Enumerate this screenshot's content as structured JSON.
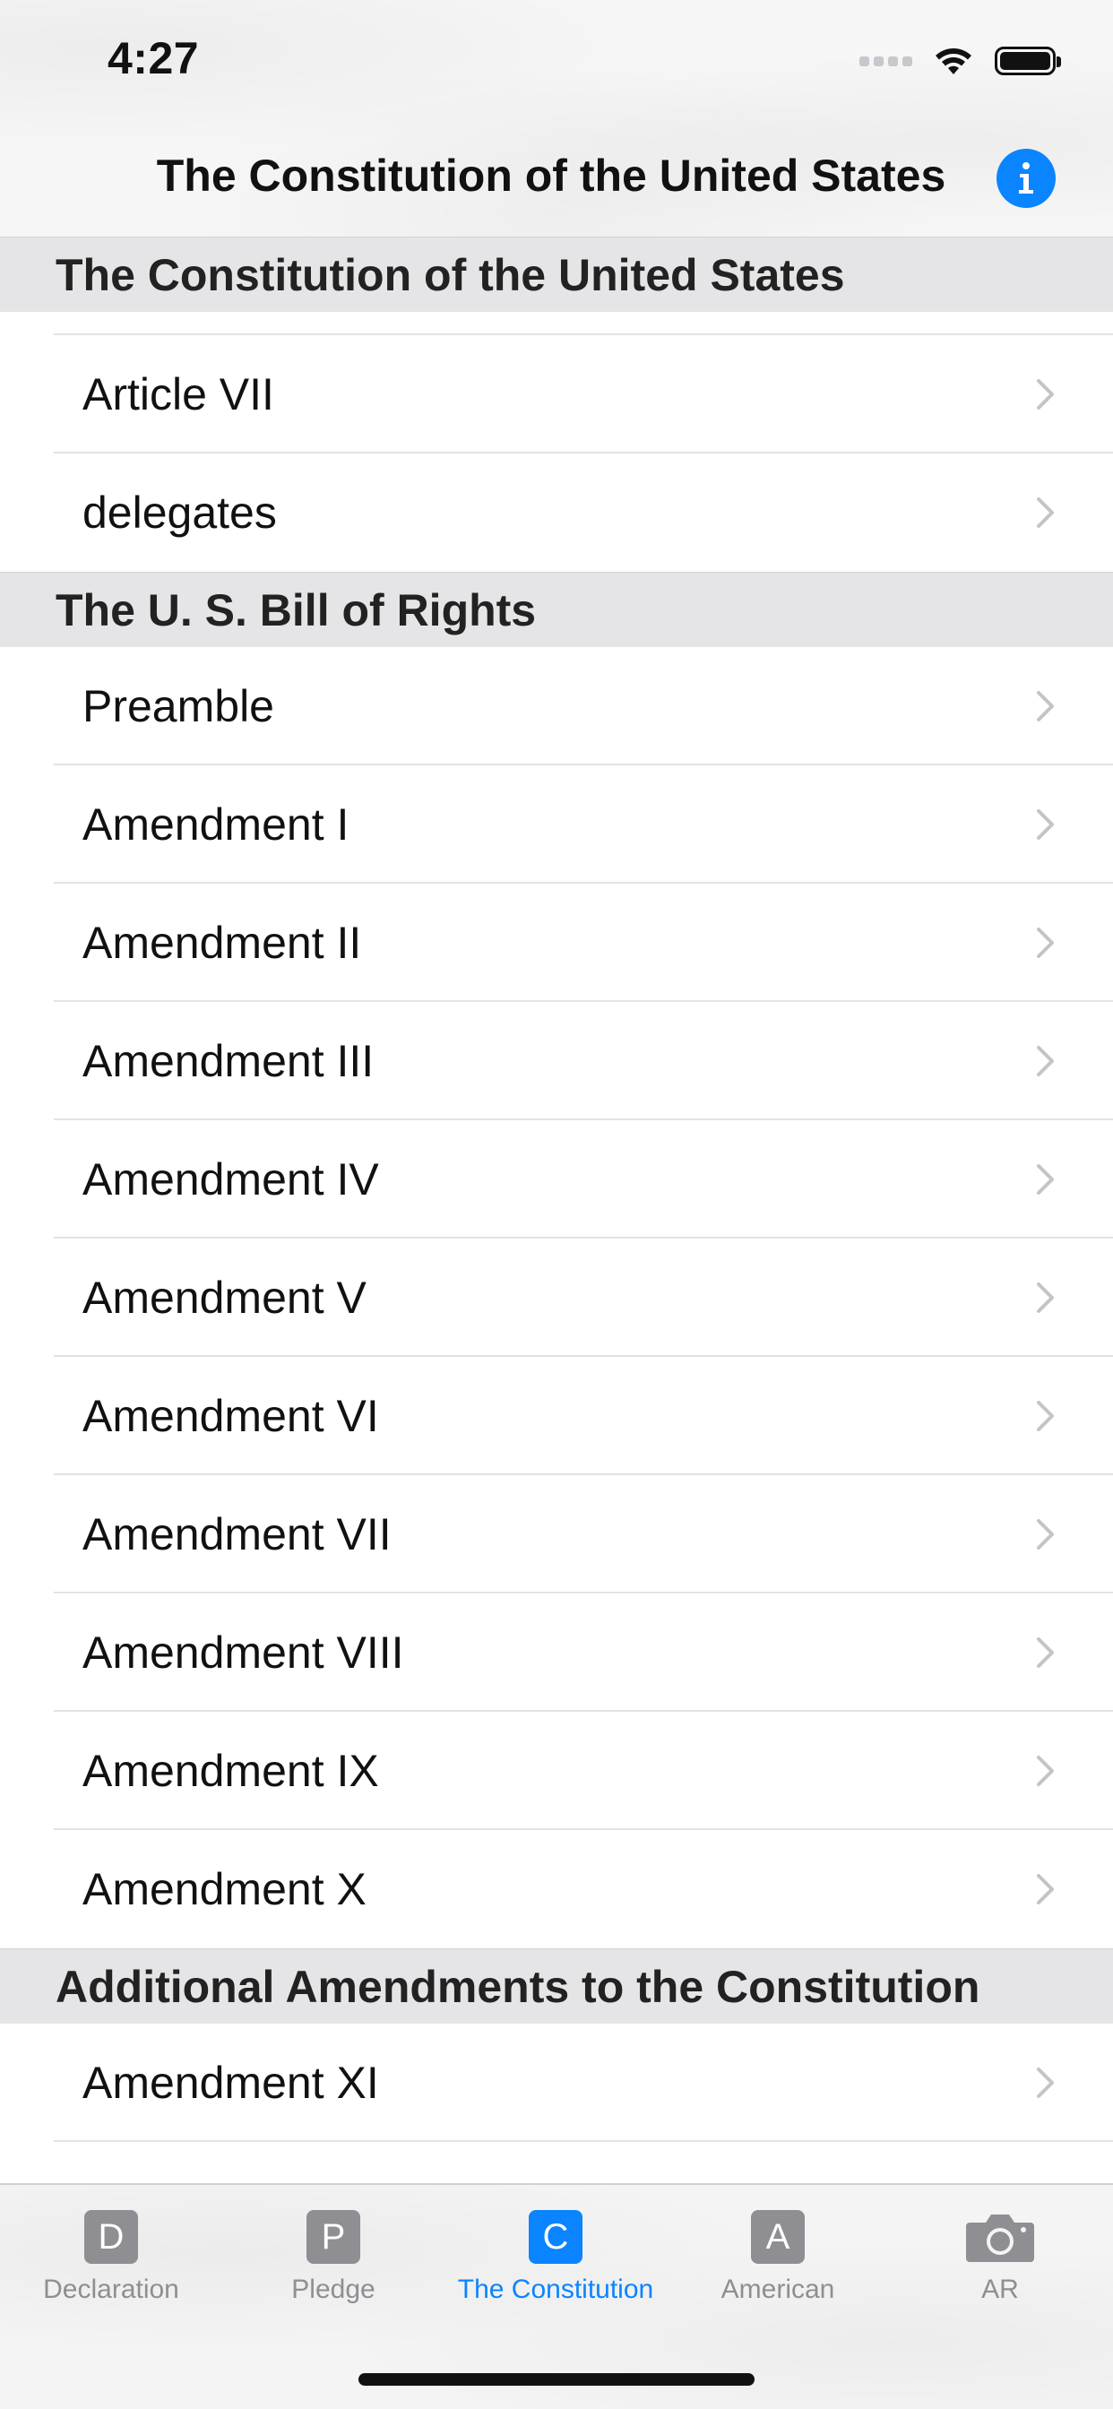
{
  "status_bar": {
    "time": "4:27"
  },
  "nav": {
    "title": "The Constitution of the United States",
    "info_icon": "info-icon"
  },
  "sections": [
    {
      "header": "The Constitution of the United States",
      "rows": [
        "Article VII",
        "delegates"
      ]
    },
    {
      "header": "The U. S. Bill of Rights",
      "rows": [
        "Preamble",
        "Amendment I",
        "Amendment II",
        "Amendment III",
        "Amendment IV",
        "Amendment V",
        "Amendment VI",
        "Amendment VII",
        "Amendment VIII",
        "Amendment IX",
        "Amendment X"
      ]
    },
    {
      "header": "Additional Amendments to the Constitution",
      "rows": [
        "Amendment XI"
      ]
    }
  ],
  "tabs": [
    {
      "letter": "D",
      "label": "Declaration"
    },
    {
      "letter": "P",
      "label": "Pledge"
    },
    {
      "letter": "C",
      "label": "The Constitution"
    },
    {
      "letter": "A",
      "label": "American"
    },
    {
      "letter": "",
      "label": "AR"
    }
  ],
  "active_tab": "The Constitution",
  "colors": {
    "accent": "#0a84ff",
    "inactive": "#8e8e93",
    "section_bg": "#e5e5e7"
  }
}
